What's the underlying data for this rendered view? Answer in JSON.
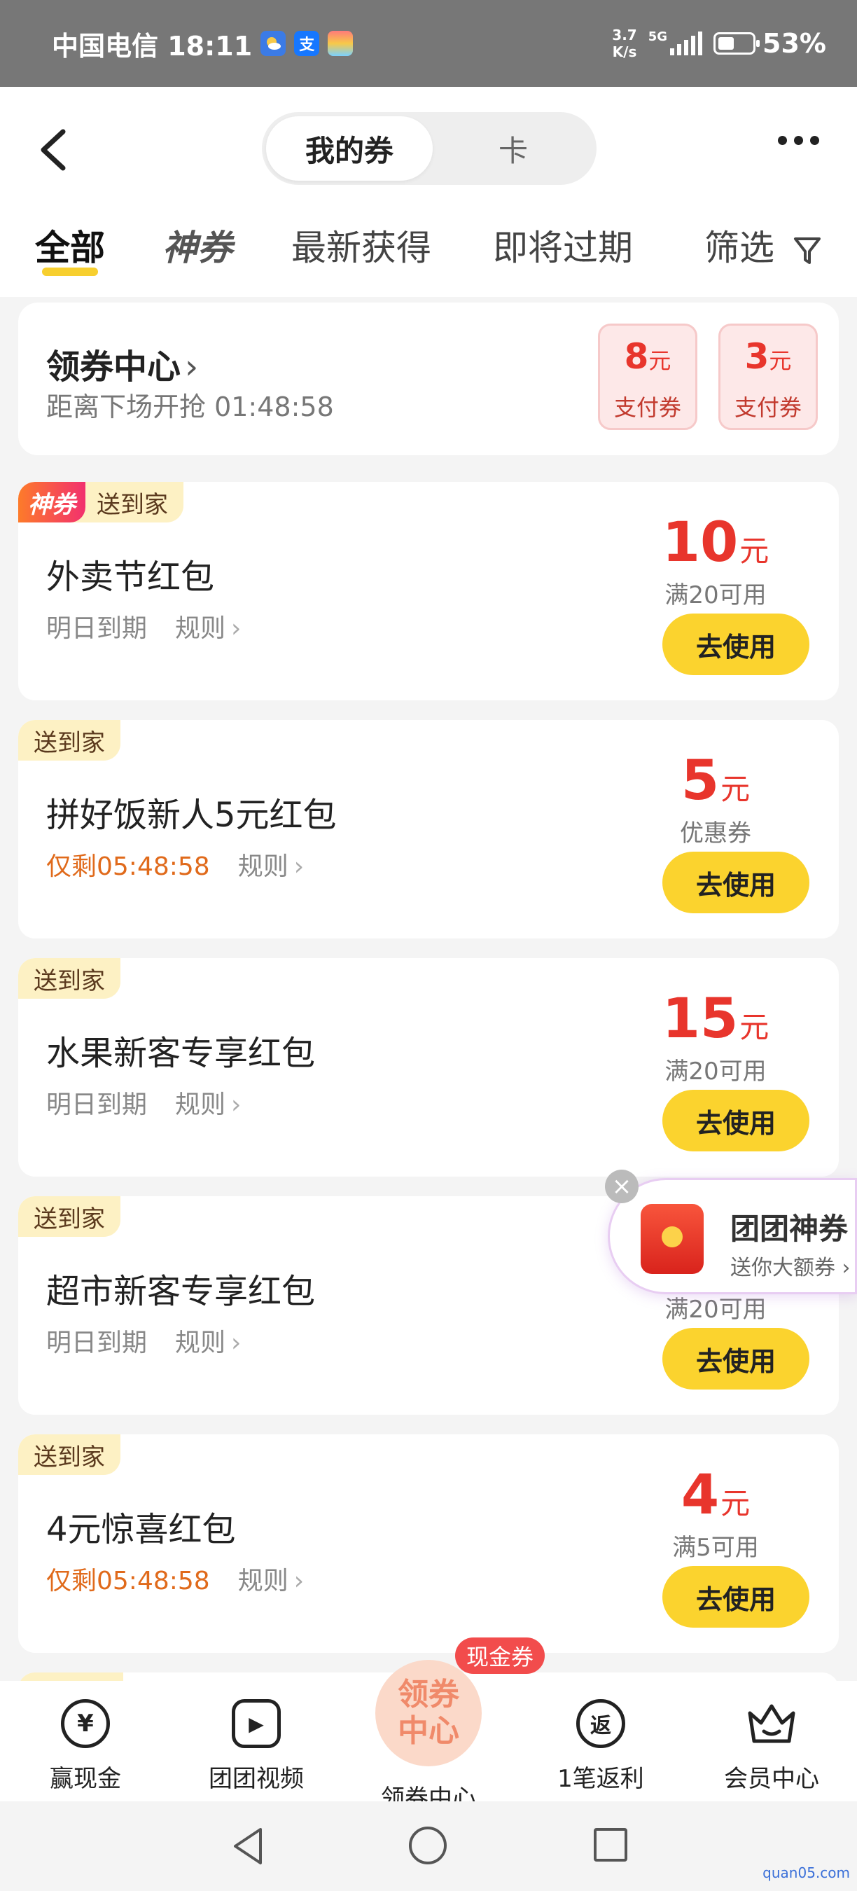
{
  "status_bar": {
    "carrier_time": "中国电信 18:11",
    "app_icons": [
      "weather-icon",
      "alipay-icon",
      "app-icon"
    ],
    "alipay_glyph": "支",
    "speed_value": "3.7",
    "speed_unit": "K/s",
    "network": "5G",
    "battery_percent": "53%"
  },
  "header": {
    "segment_active": "我的券",
    "segment_inactive": "卡",
    "tabs": [
      "全部",
      "神券",
      "最新获得",
      "即将过期",
      "筛选"
    ]
  },
  "coupon_center": {
    "title": "领券中心",
    "chevron": "›",
    "countdown": "距离下场开抢 01:48:58",
    "mini_coupons": [
      {
        "amount": "8",
        "unit": "元",
        "label": "支付券"
      },
      {
        "amount": "3",
        "unit": "元",
        "label": "支付券"
      }
    ]
  },
  "coupons": [
    {
      "god_tag": "神券",
      "home_tag": "送到家",
      "title": "外卖节红包",
      "expiry": "明日到期",
      "rule": "规则",
      "amount": "10",
      "unit": "元",
      "condition": "满20可用",
      "button": "去使用"
    },
    {
      "home_tag": "送到家",
      "title": "拼好饭新人5元红包",
      "expiry": "仅剩05:48:58",
      "rule": "规则",
      "amount": "5",
      "unit": "元",
      "condition": "优惠券",
      "button": "去使用"
    },
    {
      "home_tag": "送到家",
      "title": "水果新客专享红包",
      "expiry": "明日到期",
      "rule": "规则",
      "amount": "15",
      "unit": "元",
      "condition": "满20可用",
      "button": "去使用"
    },
    {
      "home_tag": "送到家",
      "title": "超市新客专享红包",
      "expiry": "明日到期",
      "rule": "规则",
      "condition": "满20可用",
      "button": "去使用"
    },
    {
      "home_tag": "送到家",
      "title": "4元惊喜红包",
      "expiry": "仅剩05:48:58",
      "rule": "规则",
      "amount": "4",
      "unit": "元",
      "condition": "满5可用",
      "button": "去使用"
    }
  ],
  "promo": {
    "close": "×",
    "title": "团团神券",
    "subtitle": "送你大额券 ›"
  },
  "bottom_nav": {
    "items": [
      {
        "label": "赢现金",
        "glyph": "¥"
      },
      {
        "label": "团团视频",
        "glyph": "▶"
      },
      {
        "label": "1笔返利",
        "glyph": "返"
      },
      {
        "label": "会员中心",
        "glyph": ""
      }
    ],
    "center": {
      "circle_text": "领券中心",
      "label": "领券中心",
      "badge": "现金券"
    }
  },
  "colors": {
    "accent_yellow": "#fbd32e",
    "price_red": "#e8352c",
    "urgent_orange": "#e06a1b"
  },
  "watermark": "quan05.com"
}
